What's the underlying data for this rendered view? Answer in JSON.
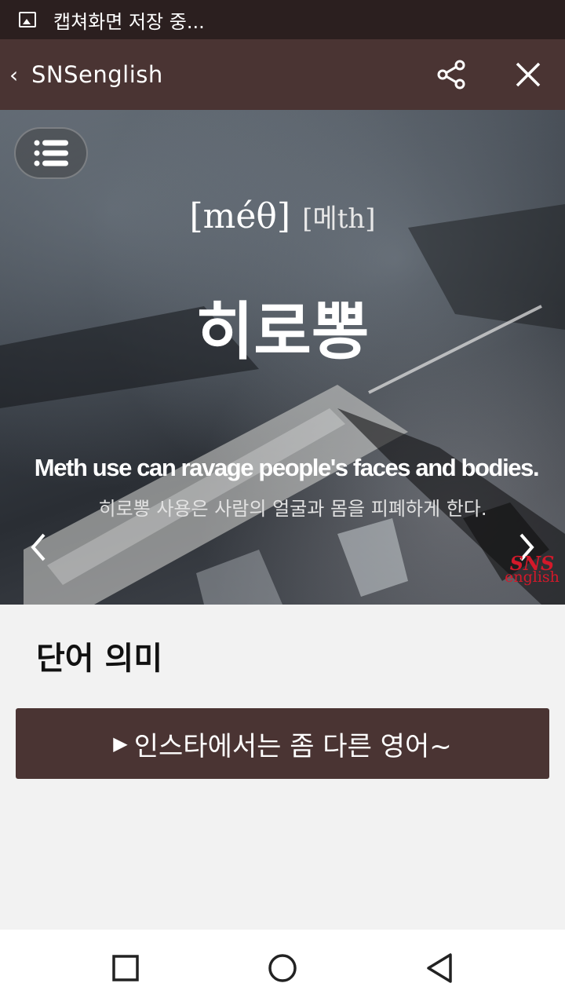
{
  "status_bar": {
    "icon": "image-icon",
    "text": "캡쳐화면 저장 중..."
  },
  "top_bar": {
    "back_icon": "‹",
    "title": "SNSenglish",
    "share_icon": "share-icon",
    "close_icon": "close-icon"
  },
  "banner": {
    "menu_icon": "list-icon",
    "pron_ipa": "[méθ]",
    "pron_ko": "[메th]",
    "word": "히로뽕",
    "sentence_en": "Meth use can ravage people's faces and bodies.",
    "sentence_ko": "히로뽕 사용은 사람의 얼굴과 몸을 피폐하게 한다.",
    "logo_line1": "SNS",
    "logo_line2": "english",
    "logo_color": "#d4192a"
  },
  "content": {
    "section_title": "단어 의미",
    "cta_arrow": "▶",
    "cta_label": "인스타에서는 좀 다른 영어~"
  },
  "nav_bar": {
    "recents_icon": "square-icon",
    "home_icon": "circle-icon",
    "back_icon": "triangle-back-icon"
  },
  "colors": {
    "header": "#4a3433",
    "status": "#2b1f1f",
    "background": "#f2f2f2"
  }
}
